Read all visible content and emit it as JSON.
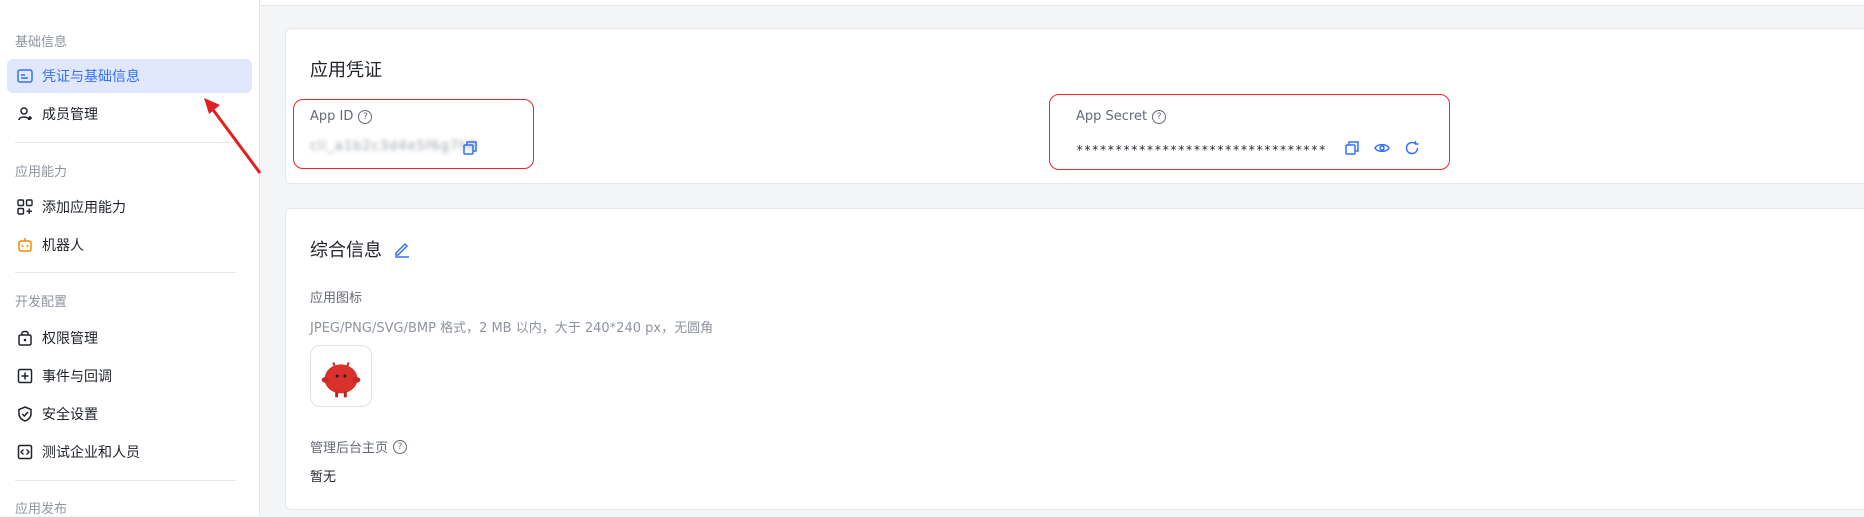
{
  "sidebar": {
    "sections": [
      {
        "title": "基础信息",
        "items": [
          {
            "label": "凭证与基础信息",
            "icon": "id-card-icon",
            "active": true
          },
          {
            "label": "成员管理",
            "icon": "add-user-icon"
          }
        ]
      },
      {
        "title": "应用能力",
        "items": [
          {
            "label": "添加应用能力",
            "icon": "grid-plus-icon"
          },
          {
            "label": "机器人",
            "icon": "robot-icon"
          }
        ]
      },
      {
        "title": "开发配置",
        "items": [
          {
            "label": "权限管理",
            "icon": "lock-bag-icon"
          },
          {
            "label": "事件与回调",
            "icon": "event-plus-icon"
          },
          {
            "label": "安全设置",
            "icon": "shield-check-icon"
          },
          {
            "label": "测试企业和人员",
            "icon": "code-window-icon"
          }
        ]
      },
      {
        "title": "应用发布",
        "items": []
      }
    ]
  },
  "credentials": {
    "title": "应用凭证",
    "app_id_label": "App ID",
    "app_id_value": "cli_a1b2c3d4e5f6g7h8",
    "app_secret_label": "App Secret",
    "app_secret_value": "********************************"
  },
  "general": {
    "title": "综合信息",
    "icon_label": "应用图标",
    "icon_hint": "JPEG/PNG/SVG/BMP 格式，2 MB 以内，大于 240*240 px，无圆角",
    "homepage_label": "管理后台主页",
    "homepage_value": "暂无"
  },
  "colors": {
    "accent": "#3370ff",
    "highlight_border": "#f5222d",
    "active_bg": "#e1e8fe"
  }
}
